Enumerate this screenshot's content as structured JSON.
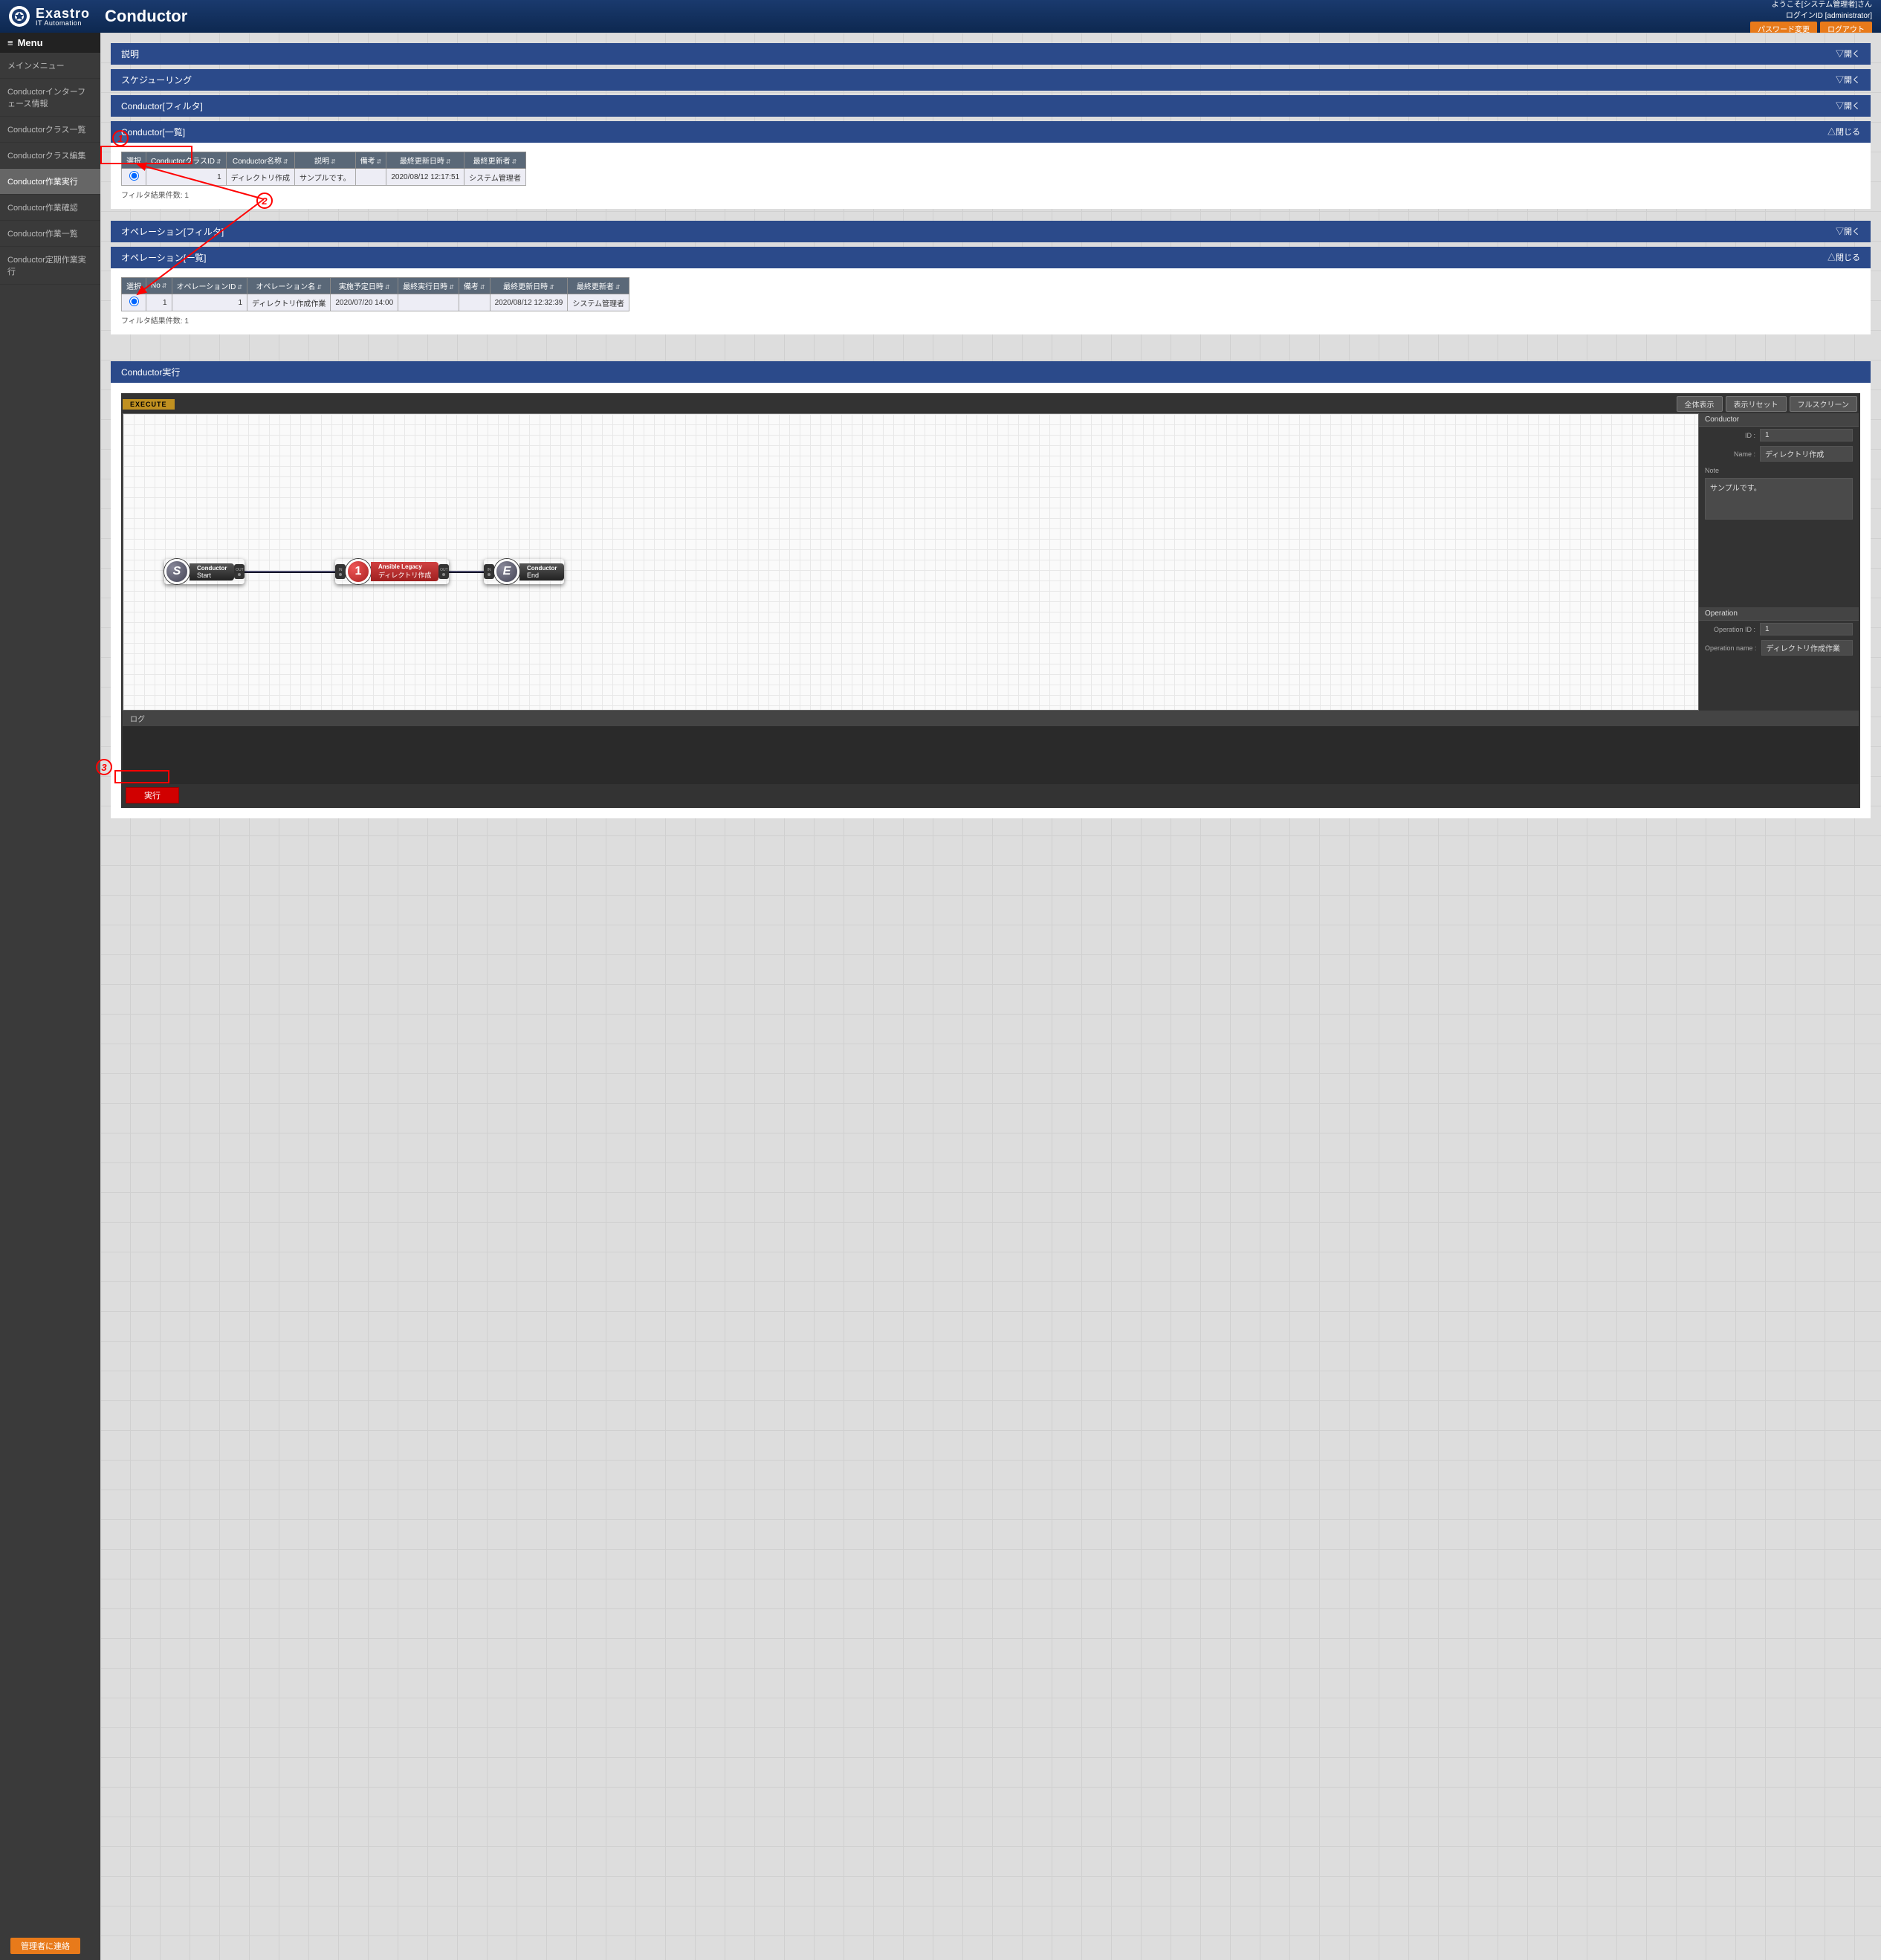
{
  "header": {
    "brand": "Exastro",
    "brand_sub": "IT Automation",
    "page_title": "Conductor",
    "welcome": "ようこそ[システム管理者]さん",
    "login_id": "ログインID [administrator]",
    "btn_pw": "パスワード変更",
    "btn_logout": "ログアウト"
  },
  "menu": {
    "header": "Menu",
    "items": [
      {
        "label": "メインメニュー"
      },
      {
        "label": "Conductorインターフェース情報"
      },
      {
        "label": "Conductorクラス一覧"
      },
      {
        "label": "Conductorクラス編集"
      },
      {
        "label": "Conductor作業実行",
        "active": true
      },
      {
        "label": "Conductor作業確認"
      },
      {
        "label": "Conductor作業一覧"
      },
      {
        "label": "Conductor定期作業実行"
      }
    ]
  },
  "panels": {
    "desc": {
      "title": "説明",
      "toggle": "▽開く"
    },
    "sched": {
      "title": "スケジューリング",
      "toggle": "▽開く"
    },
    "cfilter": {
      "title": "Conductor[フィルタ]",
      "toggle": "▽開く"
    },
    "clist": {
      "title": "Conductor[一覧]",
      "toggle": "△閉じる"
    },
    "ofilter": {
      "title": "オペレーション[フィルタ]",
      "toggle": "▽開く"
    },
    "olist": {
      "title": "オペレーション[一覧]",
      "toggle": "△閉じる"
    },
    "exec": {
      "title": "Conductor実行"
    }
  },
  "ctable": {
    "headers": [
      "選択",
      "ConductorクラスID",
      "Conductor名称",
      "説明",
      "備考",
      "最終更新日時",
      "最終更新者"
    ],
    "row": {
      "id": "1",
      "name": "ディレクトリ作成",
      "desc": "サンプルです。",
      "note": "",
      "updated": "2020/08/12 12:17:51",
      "updater": "システム管理者"
    },
    "count": "フィルタ結果件数: 1"
  },
  "otable": {
    "headers": [
      "選択",
      "No",
      "オペレーションID",
      "オペレーション名",
      "実施予定日時",
      "最終実行日時",
      "備考",
      "最終更新日時",
      "最終更新者"
    ],
    "row": {
      "no": "1",
      "id": "1",
      "name": "ディレクトリ作成作業",
      "plan": "2020/07/20 14:00",
      "last": "",
      "note": "",
      "updated": "2020/08/12 12:32:39",
      "updater": "システム管理者"
    },
    "count": "フィルタ結果件数: 1"
  },
  "canvas": {
    "tab": "EXECUTE",
    "btn_fit": "全体表示",
    "btn_reset": "表示リセット",
    "btn_full": "フルスクリーン",
    "start": {
      "t1": "Conductor",
      "t2": "Start",
      "letter": "S"
    },
    "mid": {
      "t1": "Ansible Legacy",
      "t2": "ディレクトリ作成",
      "num": "1"
    },
    "end": {
      "t1": "Conductor",
      "t2": "End",
      "letter": "E"
    },
    "port_in": "IN",
    "port_out": "OUT"
  },
  "side": {
    "sec1": "Conductor",
    "id_l": "ID :",
    "id_v": "1",
    "name_l": "Name :",
    "name_v": "ディレクトリ作成",
    "note_l": "Note",
    "note_v": "サンプルです。",
    "sec2": "Operation",
    "op_id_l": "Operation ID :",
    "op_id_v": "1",
    "op_name_l": "Operation name :",
    "op_name_v": "ディレクトリ作成作業"
  },
  "log": {
    "title": "ログ"
  },
  "run_btn": "実行",
  "footer_btn": "管理者に連絡",
  "annot": {
    "n1": "1",
    "n2": "2",
    "n3": "3"
  }
}
